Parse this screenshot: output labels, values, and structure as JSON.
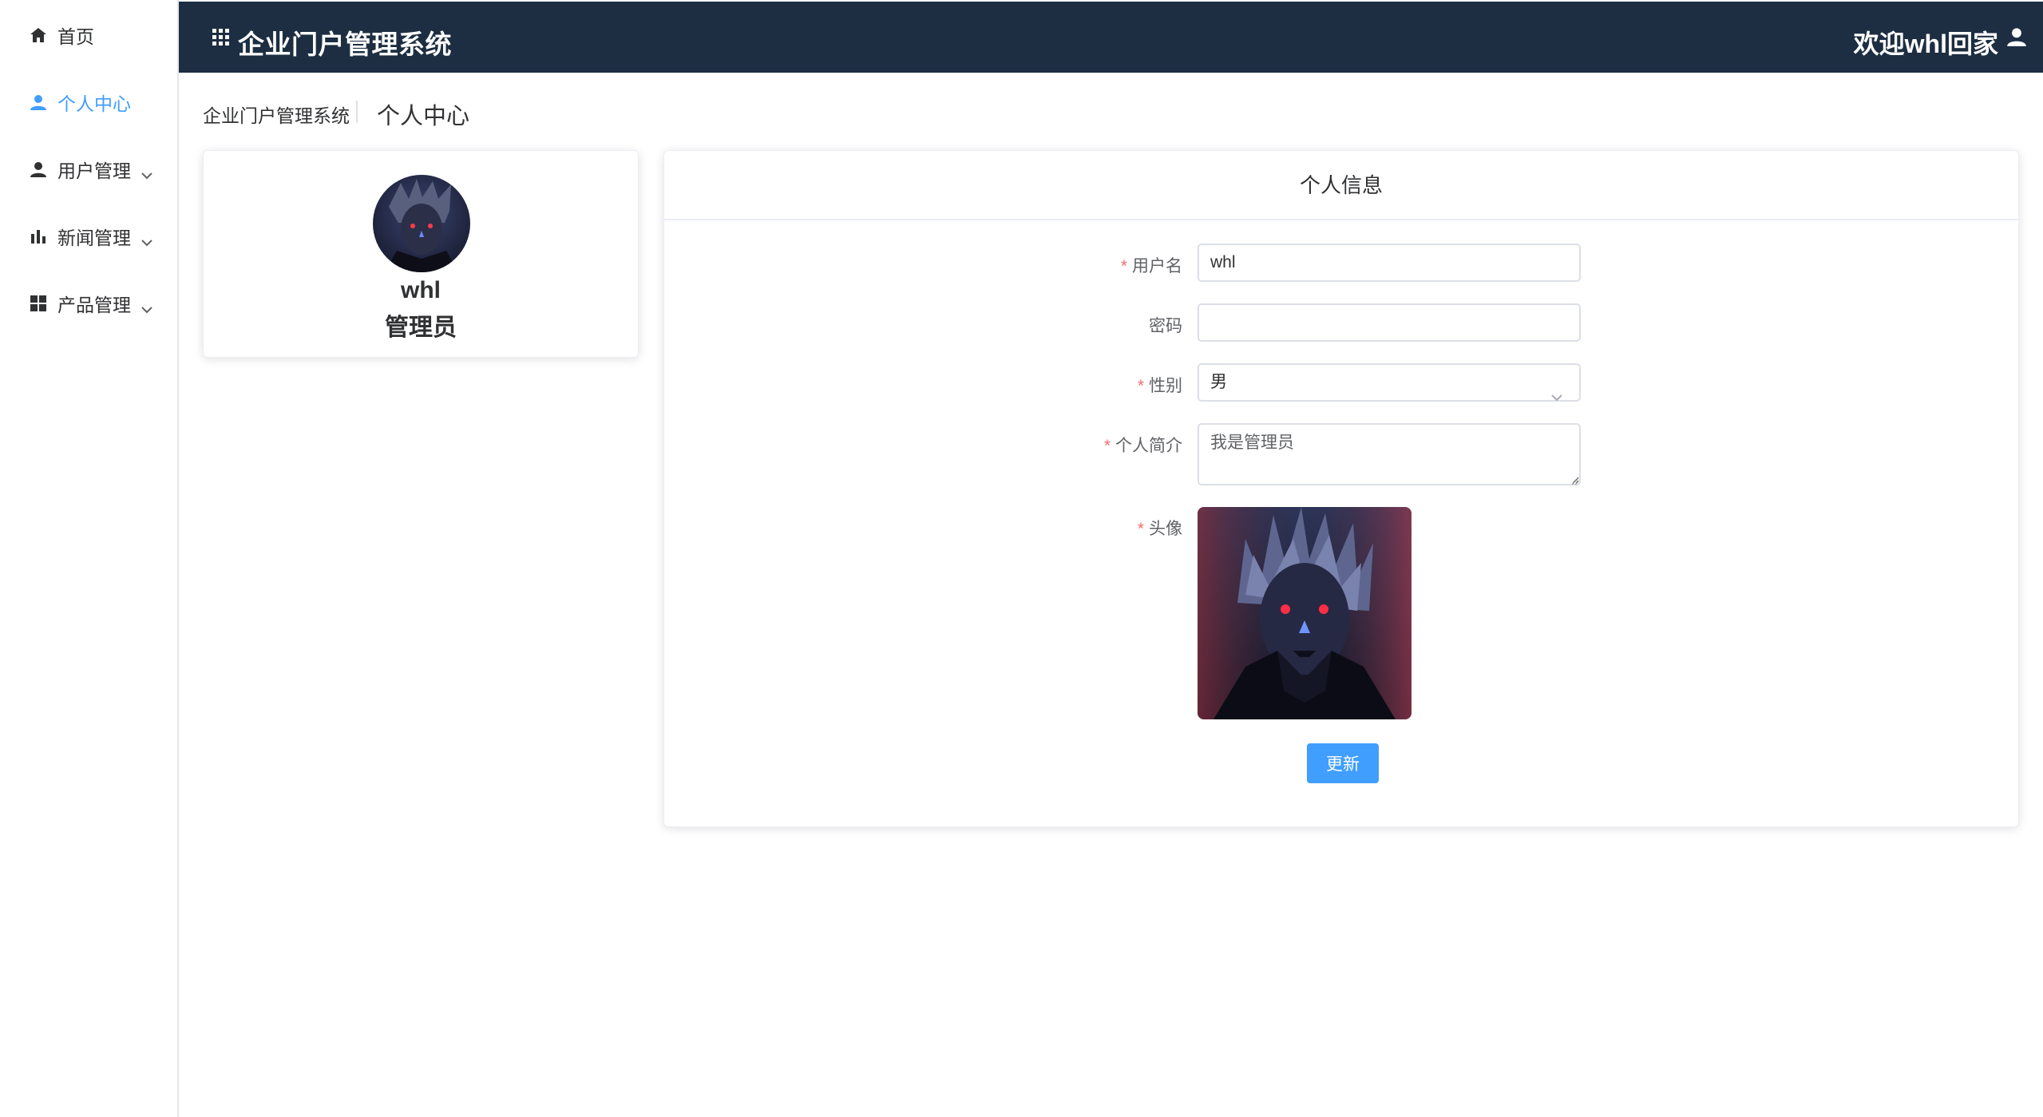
{
  "sidebar": {
    "items": [
      {
        "label": "首页",
        "icon": "home-icon"
      },
      {
        "label": "个人中心",
        "icon": "user-icon",
        "active": true
      },
      {
        "label": "用户管理",
        "icon": "user-icon",
        "expandable": true
      },
      {
        "label": "新闻管理",
        "icon": "bar-chart-icon",
        "expandable": true
      },
      {
        "label": "产品管理",
        "icon": "grid-icon",
        "expandable": true
      }
    ]
  },
  "header": {
    "title": "企业门户管理系统",
    "welcome": "欢迎whl回家"
  },
  "breadcrumb": {
    "root": "企业门户管理系统",
    "current": "个人中心"
  },
  "profile": {
    "username": "whl",
    "role": "管理员"
  },
  "info": {
    "title": "个人信息",
    "fields": {
      "username": {
        "label": "用户名",
        "value": "whl",
        "required": true
      },
      "password": {
        "label": "密码",
        "value": "",
        "required": false
      },
      "gender": {
        "label": "性别",
        "value": "男",
        "required": true
      },
      "intro": {
        "label": "个人简介",
        "value": "我是管理员",
        "required": true
      },
      "avatar": {
        "label": "头像",
        "required": true
      }
    },
    "submit_label": "更新"
  },
  "colors": {
    "header_bg": "#1d2e42",
    "accent": "#409eff",
    "required": "#f56c6c"
  }
}
